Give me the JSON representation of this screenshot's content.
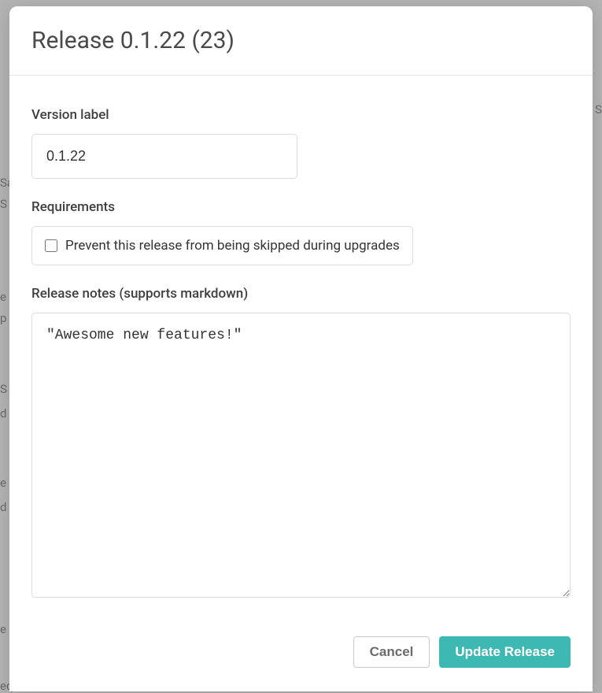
{
  "modal": {
    "title": "Release 0.1.22 (23)"
  },
  "form": {
    "version_label_title": "Version label",
    "version_label_value": "0.1.22",
    "requirements_title": "Requirements",
    "prevent_skip_label": "Prevent this release from being skipped during upgrades",
    "prevent_skip_checked": false,
    "release_notes_title": "Release notes (supports markdown)",
    "release_notes_value": "\"Awesome new features!\""
  },
  "footer": {
    "cancel_label": "Cancel",
    "update_label": "Update Release"
  },
  "backdrop": {
    "sa": "Sa",
    "s1": "S",
    "e1": "e",
    "p": "p",
    "s2": "S",
    "d1": "d",
    "e2": "e",
    "d2": "d",
    "e3": "e",
    "seq": "equence"
  }
}
